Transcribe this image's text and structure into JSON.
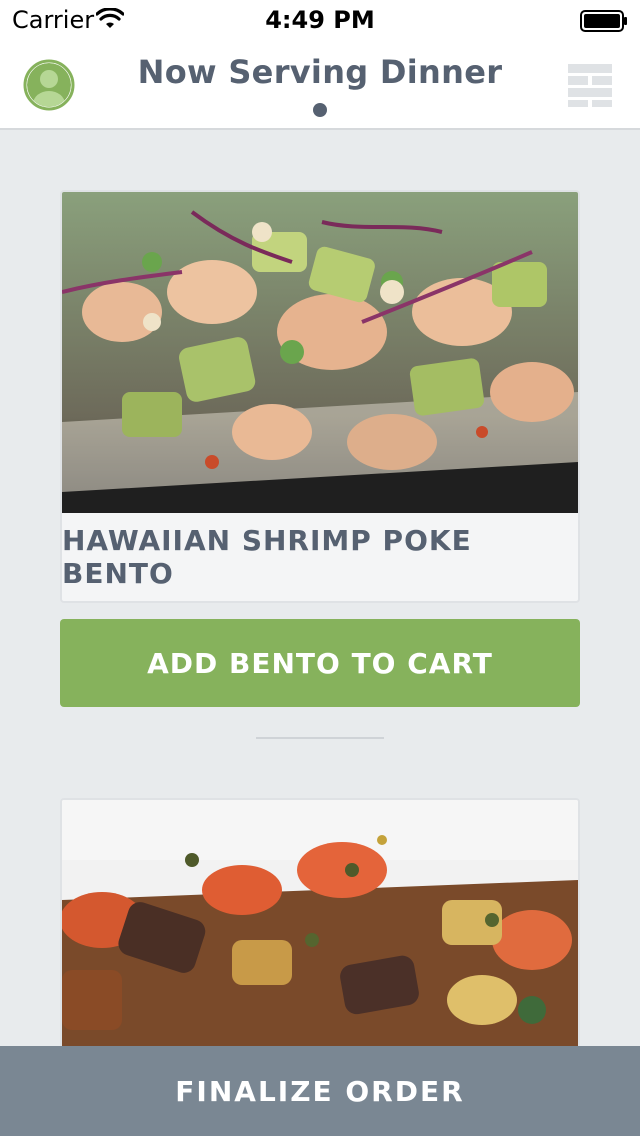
{
  "status_bar": {
    "carrier": "Carrier",
    "time": "4:49 PM"
  },
  "nav": {
    "title": "Now Serving Dinner",
    "icons": {
      "left": "profile-icon",
      "right": "grid-menu-icon"
    }
  },
  "menu": {
    "items": [
      {
        "name": "HAWAIIAN SHRIMP POKE BENTO",
        "add_label": "ADD BENTO TO CART"
      }
    ]
  },
  "footer": {
    "finalize_label": "FINALIZE ORDER"
  },
  "colors": {
    "accent_green": "#86b25c",
    "title_gray": "#566171",
    "footer_gray": "#7a8793",
    "background": "#e8ebed"
  }
}
